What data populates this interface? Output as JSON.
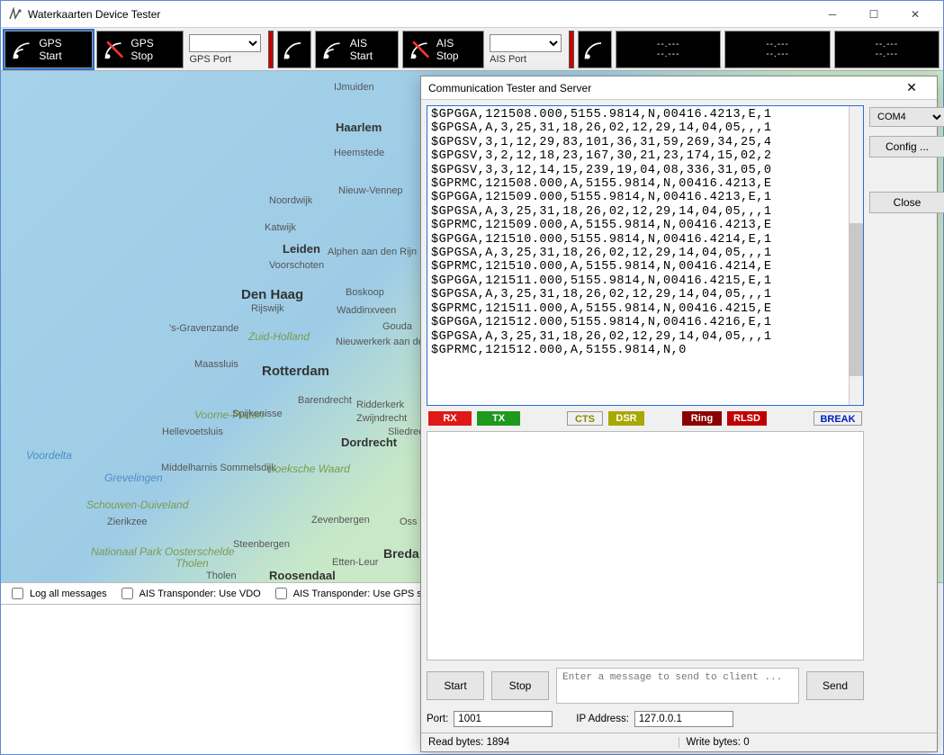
{
  "window": {
    "title": "Waterkaarten Device Tester"
  },
  "toolbar": {
    "gps_start": "GPS Start",
    "gps_stop": "GPS Stop",
    "gps_port_label": "GPS Port",
    "ais_start": "AIS Start",
    "ais_stop": "AIS Stop",
    "ais_port_label": "AIS Port",
    "display_dash": "--.---",
    "display_dash2": "--.---"
  },
  "map": {
    "labels": {
      "ijmuiden": "IJmuiden",
      "haarlem": "Haarlem",
      "heemstede": "Heemstede",
      "nieuwvennep": "Nieuw-Vennep",
      "noordwijk": "Noordwijk",
      "katwijk": "Katwijk",
      "leiden": "Leiden",
      "alphen": "Alphen aan den Rijn",
      "voorschoten": "Voorschoten",
      "denhaag": "Den Haag",
      "rijswijk": "Rijswijk",
      "boskoop": "Boskoop",
      "waddinxveen": "Waddinxveen",
      "gouda": "Gouda",
      "sgravenzande": "'s-Gravenzande",
      "zuidholland": "Zuid-Holland",
      "nieuwerkerk": "Nieuwerkerk aan den IJssel",
      "maassluis": "Maassluis",
      "rotterdam": "Rotterdam",
      "voorneputten": "Voorne-Putten",
      "spijkenisse": "Spijkenisse",
      "hellevoetsluis": "Hellevoetsluis",
      "barendrecht": "Barendrecht",
      "zwijndrecht": "Zwijndrecht",
      "ridderkerk": "Ridderkerk",
      "sliedrecht": "Sliedrecht",
      "dordrecht": "Dordrecht",
      "voordelta": "Voordelta",
      "middelharnis": "Middelharnis Sommelsdijk",
      "hoeksche": "Hoeksche Waard",
      "grevelingen": "Grevelingen",
      "schouwen": "Schouwen-Duiveland",
      "zierikzee": "Zierikzee",
      "ooster": "Nationaal Park Oosterschelde",
      "tholen": "Tholen",
      "tholen2": "Tholen",
      "steenbergen": "Steenbergen",
      "zevenbergen": "Zevenbergen",
      "oss": "Oss",
      "ettenleur": "Etten-Leur",
      "roosendaal": "Roosendaal",
      "breda": "Breda"
    },
    "options": {
      "log_all": "Log all messages",
      "ais_vdo": "AIS Transponder: Use VDO",
      "ais_gps": "AIS Transponder: Use GPS signal"
    }
  },
  "dialog": {
    "title": "Communication Tester and Server",
    "nmea_lines": [
      "$GPGGA,121508.000,5155.9814,N,00416.4213,E,1",
      "$GPGSA,A,3,25,31,18,26,02,12,29,14,04,05,,,1",
      "$GPGSV,3,1,12,29,83,101,36,31,59,269,34,25,4",
      "$GPGSV,3,2,12,18,23,167,30,21,23,174,15,02,2",
      "$GPGSV,3,3,12,14,15,239,19,04,08,336,31,05,0",
      "$GPRMC,121508.000,A,5155.9814,N,00416.4213,E",
      "$GPGGA,121509.000,5155.9814,N,00416.4213,E,1",
      "$GPGSA,A,3,25,31,18,26,02,12,29,14,04,05,,,1",
      "$GPRMC,121509.000,A,5155.9814,N,00416.4213,E",
      "$GPGGA,121510.000,5155.9814,N,00416.4214,E,1",
      "$GPGSA,A,3,25,31,18,26,02,12,29,14,04,05,,,1",
      "$GPRMC,121510.000,A,5155.9814,N,00416.4214,E",
      "$GPGGA,121511.000,5155.9814,N,00416.4215,E,1",
      "$GPGSA,A,3,25,31,18,26,02,12,29,14,04,05,,,1",
      "$GPRMC,121511.000,A,5155.9814,N,00416.4215,E",
      "$GPGGA,121512.000,5155.9814,N,00416.4216,E,1",
      "$GPGSA,A,3,25,31,18,26,02,12,29,14,04,05,,,1",
      "$GPRMC,121512.000,A,5155.9814,N,0"
    ],
    "indicators": {
      "rx": "RX",
      "tx": "TX",
      "cts": "CTS",
      "dsr": "DSR",
      "ring": "Ring",
      "rlsd": "RLSD",
      "break": "BREAK"
    },
    "buttons": {
      "start": "Start",
      "stop": "Stop",
      "send": "Send",
      "config": "Config ...",
      "close": "Close"
    },
    "com_select": "COM4",
    "msg_placeholder": "Enter a message to send to client ...",
    "port_label": "Port:",
    "port_value": "1001",
    "ip_label": "IP Address:",
    "ip_value": "127.0.0.1",
    "read_label": "Read bytes:",
    "read_value": "1894",
    "write_label": "Write bytes:",
    "write_value": "0"
  }
}
